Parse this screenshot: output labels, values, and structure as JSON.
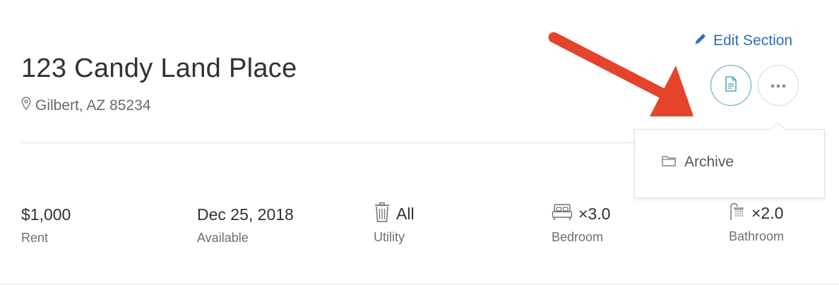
{
  "property": {
    "title": "123 Candy Land Place",
    "location": "Gilbert, AZ 85234"
  },
  "header": {
    "edit_label": "Edit Section"
  },
  "menu": {
    "items": [
      {
        "label": "Archive",
        "icon": "folder-icon"
      }
    ]
  },
  "stats": [
    {
      "value": "$1,000",
      "label": "Rent",
      "icon": null
    },
    {
      "value": "Dec 25, 2018",
      "label": "Available",
      "icon": null
    },
    {
      "value": "All",
      "label": "Utility",
      "icon": "trash-icon"
    },
    {
      "value": "×3.0",
      "label": "Bedroom",
      "icon": "bed-icon"
    },
    {
      "value": "×2.0",
      "label": "Bathroom",
      "icon": "shower-icon"
    }
  ],
  "colors": {
    "accent_link": "#2e6db8",
    "teal_button": "#4aa7b1",
    "annotation_arrow": "#e5432c"
  }
}
